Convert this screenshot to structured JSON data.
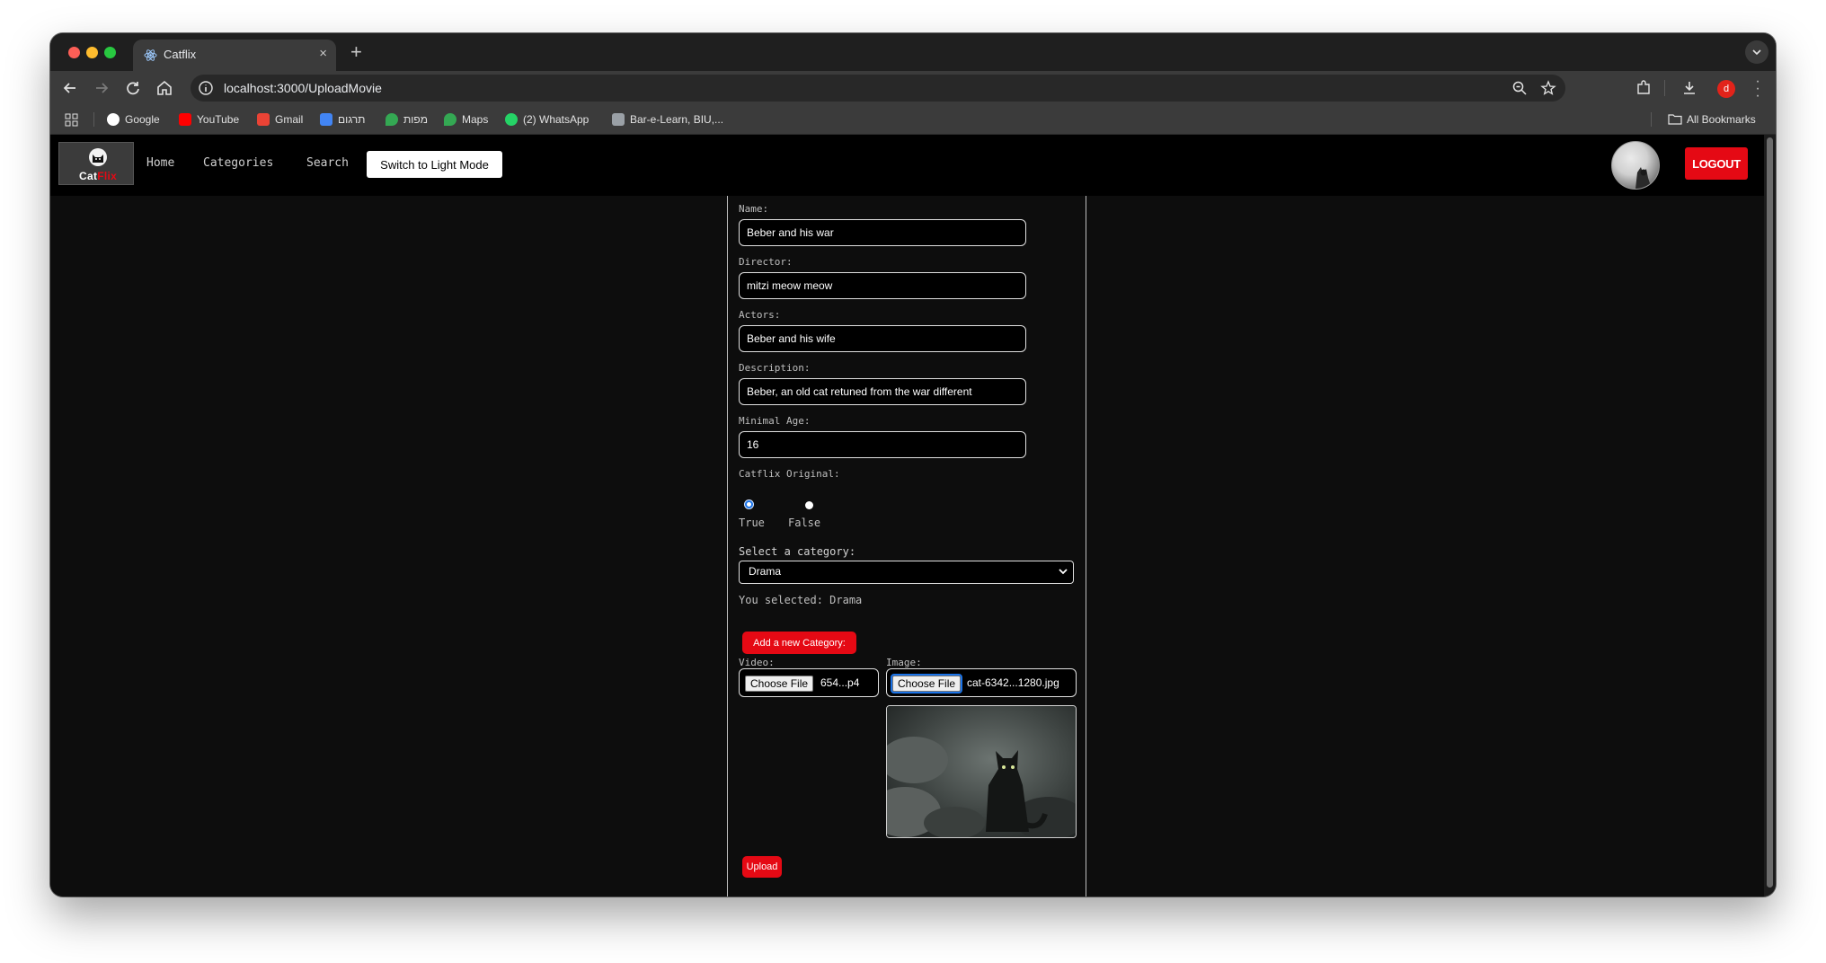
{
  "browser": {
    "tab_title": "Catflix",
    "tab_close": "×",
    "new_tab": "+",
    "url": "localhost:3000/UploadMovie",
    "profile_initial": "d",
    "bookmarks": [
      {
        "label": "Google",
        "color": "#4285f4"
      },
      {
        "label": "YouTube",
        "color": "#ff0000"
      },
      {
        "label": "Gmail",
        "color": "#ea4335"
      },
      {
        "label": "תרגום",
        "color": "#4285f4"
      },
      {
        "label": "מפות",
        "color": "#34a853"
      },
      {
        "label": "Maps",
        "color": "#34a853"
      },
      {
        "label": "(2) WhatsApp",
        "color": "#25d366"
      },
      {
        "label": "Bar-e-Learn, BIU,...",
        "color": "#9aa0a6"
      }
    ],
    "all_bookmarks": "All Bookmarks"
  },
  "app": {
    "logo_cat": "Cat",
    "logo_flix": "Flix",
    "nav": [
      "Home",
      "Categories",
      "Search"
    ],
    "mode_button": "Switch to Light Mode",
    "logout": "LOGOUT",
    "accent": "#e50914"
  },
  "form": {
    "name_label": "Name:",
    "name_value": "Beber and his war",
    "director_label": "Director:",
    "director_value": "mitzi meow meow",
    "actors_label": "Actors:",
    "actors_value": "Beber and his wife",
    "description_label": "Description:",
    "description_value": "Beber, an old cat retuned from the war different",
    "age_label": "Minimal Age:",
    "age_value": "16",
    "original_label": "Catflix Original:",
    "original_true": "True",
    "original_false": "False",
    "original_selected": "True",
    "category_label": "Select a category:",
    "category_value": "Drama",
    "selected_text": "You selected: Drama",
    "add_category_button": "Add a new Category:",
    "video_label": "Video:",
    "image_label": "Image:",
    "choose_file": "Choose File",
    "video_file": "654...p4",
    "image_file": "cat-6342...1280.jpg",
    "upload_button": "Upload"
  }
}
